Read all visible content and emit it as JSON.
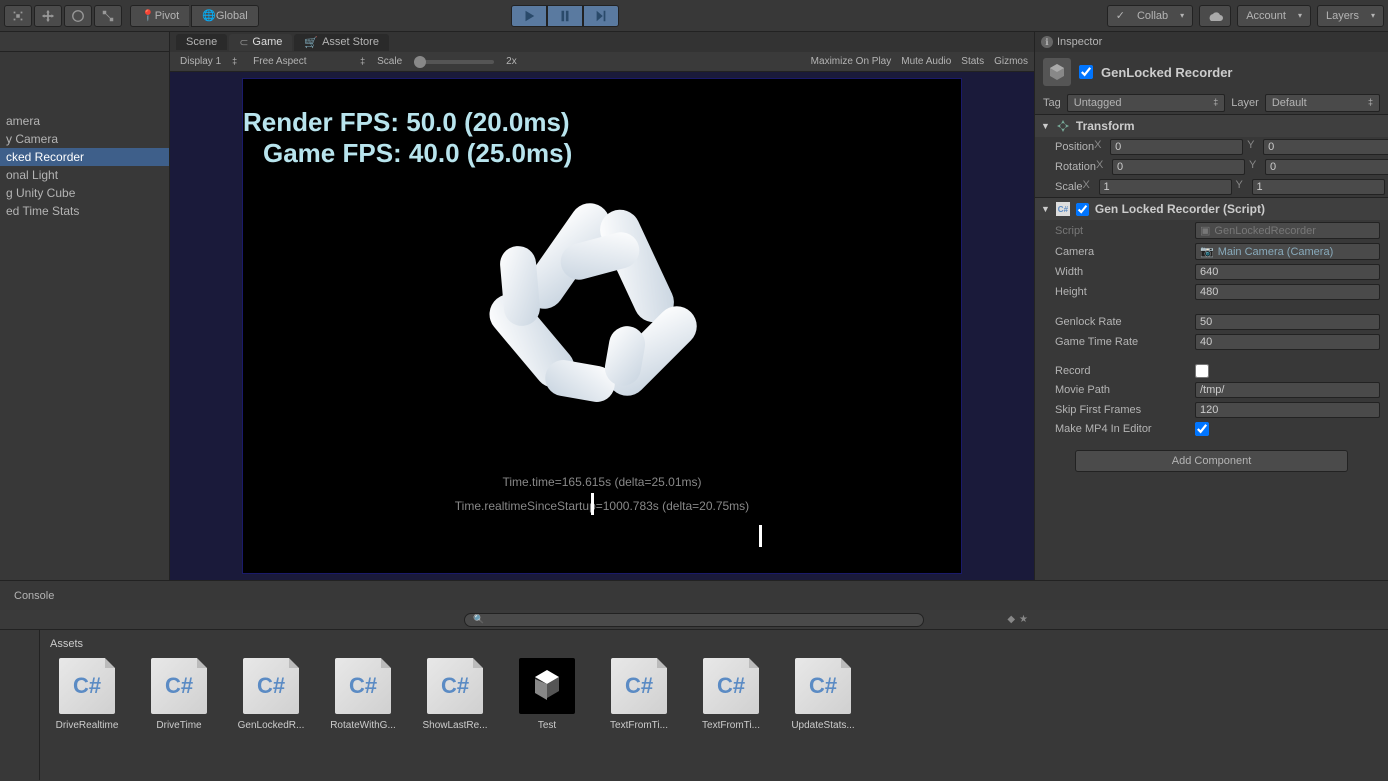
{
  "toolbar": {
    "pivot": "Pivot",
    "global": "Global",
    "collab": "Collab",
    "account": "Account",
    "layers": "Layers"
  },
  "hierarchy": {
    "items": [
      "amera",
      "y Camera",
      "cked Recorder",
      "onal Light",
      "g Unity Cube",
      "ed Time Stats"
    ],
    "selectedIndex": 2
  },
  "tabs": {
    "scene": "Scene",
    "game": "Game",
    "assetStore": "Asset Store"
  },
  "gameToolbar": {
    "display": "Display 1",
    "aspect": "Free Aspect",
    "scaleLabel": "Scale",
    "scaleValue": "2x",
    "maximize": "Maximize On Play",
    "mute": "Mute Audio",
    "stats": "Stats",
    "gizmos": "Gizmos"
  },
  "gameView": {
    "renderFps": "Render FPS: 50.0 (20.0ms)",
    "gameFps": "Game FPS: 40.0 (25.0ms)",
    "timeTime": "Time.time=165.615s (delta=25.01ms)",
    "realtime": "Time.realtimeSinceStartup=1000.783s (delta=20.75ms)"
  },
  "inspector": {
    "title": "Inspector",
    "objName": "GenLocked Recorder",
    "tagLabel": "Tag",
    "tagValue": "Untagged",
    "layerLabel": "Layer",
    "layerValue": "Default",
    "transform": {
      "title": "Transform",
      "position": {
        "label": "Position",
        "x": "0",
        "y": "0"
      },
      "rotation": {
        "label": "Rotation",
        "x": "0",
        "y": "0"
      },
      "scale": {
        "label": "Scale",
        "x": "1",
        "y": "1"
      }
    },
    "script": {
      "title": "Gen Locked Recorder (Script)",
      "scriptLabel": "Script",
      "scriptValue": "GenLockedRecorder",
      "cameraLabel": "Camera",
      "cameraValue": "Main Camera (Camera)",
      "widthLabel": "Width",
      "widthValue": "640",
      "heightLabel": "Height",
      "heightValue": "480",
      "genlockLabel": "Genlock Rate",
      "genlockValue": "50",
      "gametimeLabel": "Game Time Rate",
      "gametimeValue": "40",
      "recordLabel": "Record",
      "moviePathLabel": "Movie Path",
      "moviePathValue": "/tmp/",
      "skipLabel": "Skip First Frames",
      "skipValue": "120",
      "mp4Label": "Make MP4 In Editor"
    },
    "addComponent": "Add Component"
  },
  "console": {
    "title": "Console"
  },
  "assets": {
    "header": "Assets",
    "items": [
      {
        "type": "cs",
        "label": "DriveRealtime"
      },
      {
        "type": "cs",
        "label": "DriveTime"
      },
      {
        "type": "cs",
        "label": "GenLockedR..."
      },
      {
        "type": "cs",
        "label": "RotateWithG..."
      },
      {
        "type": "cs",
        "label": "ShowLastRe..."
      },
      {
        "type": "unity",
        "label": "Test"
      },
      {
        "type": "cs",
        "label": "TextFromTi..."
      },
      {
        "type": "cs",
        "label": "TextFromTi..."
      },
      {
        "type": "cs",
        "label": "UpdateStats..."
      }
    ]
  }
}
